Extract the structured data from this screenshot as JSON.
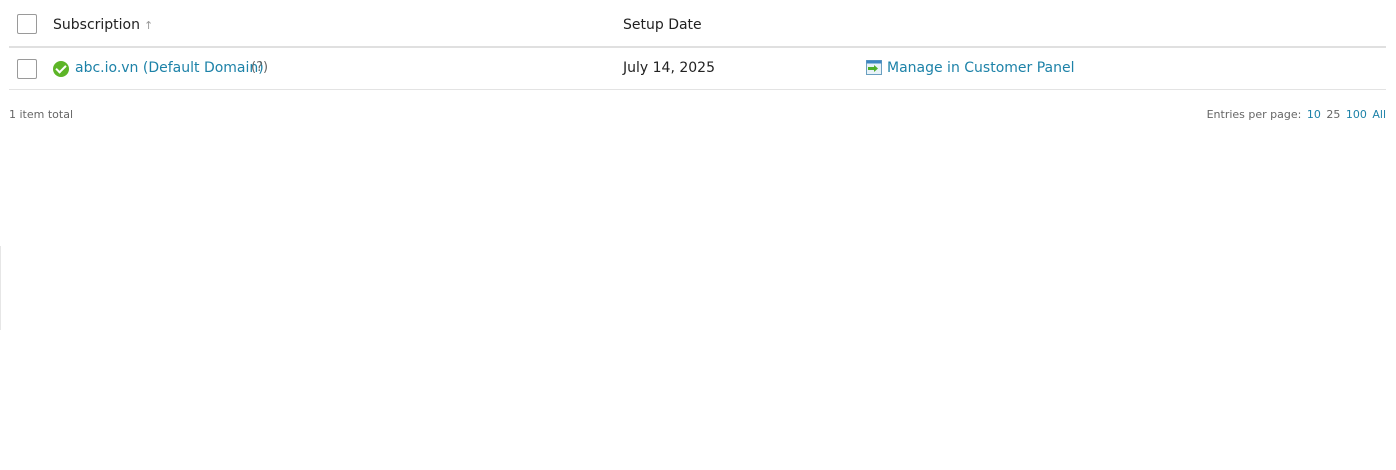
{
  "table": {
    "headers": {
      "subscription": "Subscription",
      "sort_indicator": "↑",
      "setup_date": "Setup Date"
    },
    "rows": [
      {
        "domain": "abc.io.vn (Default Domain)",
        "help": "(?)",
        "setup_date": "July 14, 2025",
        "action": "Manage in Customer Panel",
        "status": "active"
      }
    ]
  },
  "footer": {
    "total": "1 item total",
    "entries_label": "Entries per page:",
    "options": [
      "10",
      "25",
      "100",
      "All"
    ]
  },
  "colors": {
    "link": "#1d82a8",
    "status_ok": "#5db527"
  },
  "icons": {
    "status": "check-circle-icon",
    "panel": "customer-panel-icon"
  }
}
